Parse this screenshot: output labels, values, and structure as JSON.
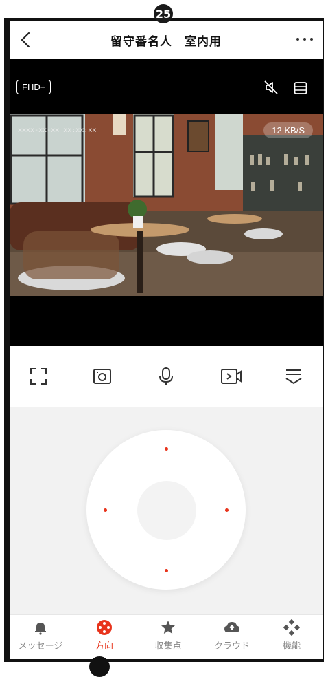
{
  "badge": "25",
  "header": {
    "title": "留守番名人　室内用"
  },
  "video": {
    "quality": "FHD+",
    "timestamp": "xxxx-xx-xx xx:xx:xx",
    "speed": "12 KB/S"
  },
  "tabs": [
    {
      "label": "メッセージ",
      "icon": "bell-icon",
      "active": false
    },
    {
      "label": "方向",
      "icon": "direction-icon",
      "active": true
    },
    {
      "label": "収集点",
      "icon": "star-icon",
      "active": false
    },
    {
      "label": "クラウド",
      "icon": "cloud-upload-icon",
      "active": false
    },
    {
      "label": "機能",
      "icon": "features-icon",
      "active": false
    }
  ],
  "colors": {
    "accent": "#e8341c",
    "background": "#f2f2f2"
  }
}
